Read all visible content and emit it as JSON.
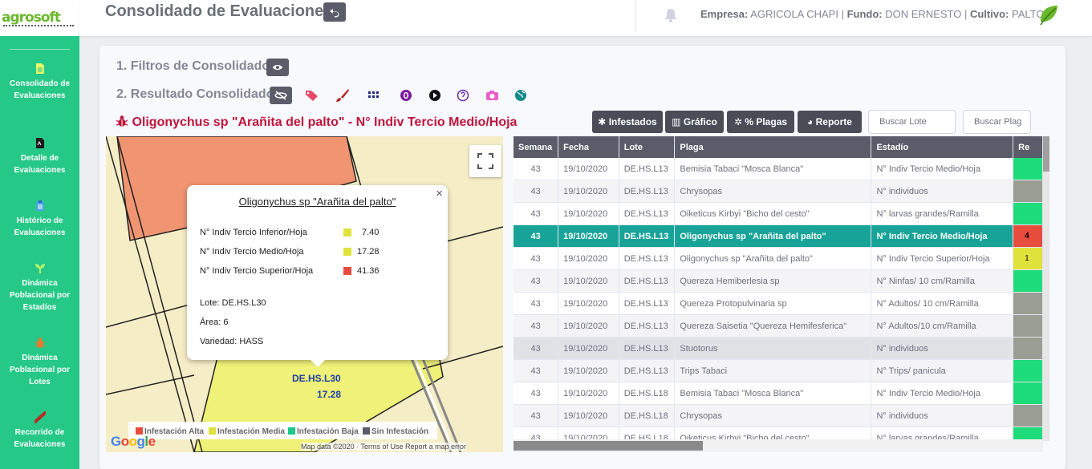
{
  "app": {
    "logo_text": "agrosoft",
    "page_title": "Consolidado de Evaluaciones"
  },
  "sidebar": {
    "items": [
      {
        "label": "Consolidado de Evaluaciones",
        "icon": "file-icon"
      },
      {
        "label": "Detalle de Evaluaciones",
        "icon": "pdf-icon"
      },
      {
        "label": "Histórico de Evaluaciones",
        "icon": "clipboard-icon"
      },
      {
        "label": "Dinámica Poblacional por Estadíos",
        "icon": "seedling-icon"
      },
      {
        "label": "Dinámica Poblacional por Lotes",
        "icon": "bug-icon"
      },
      {
        "label": "Recorrido de Evaluaciones",
        "icon": "route-icon"
      }
    ]
  },
  "header": {
    "empresa_label": "Empresa:",
    "empresa_value": "AGRICOLA CHAPI",
    "fundo_label": "Fundo:",
    "fundo_value": "DON ERNESTO",
    "cultivo_label": "Cultivo:",
    "cultivo_value": "PALTO"
  },
  "sections": {
    "filtros": "1. Filtros de Consolidado",
    "resultado": "2. Resultado Consolidado"
  },
  "toolbar_icon_colors": {
    "eye_slash": "#5a5c69",
    "tags": "#e74a6b",
    "brush": "#b52a26",
    "grid": "#1f2a8a",
    "circle_0": "#7a1aa0",
    "play": "#111111",
    "question": "#6a2aa8",
    "camera": "#e85fc4",
    "globe": "#138a8a"
  },
  "map": {
    "title": "Oligonychus sp \"Arañita del palto\" - N° Indiv Tercio Medio/Hoja",
    "popup": {
      "title": "Oligonychus sp \"Arañita del palto\"",
      "close": "×",
      "rows": [
        {
          "label": "N° Indiv Tercio Inferior/Hoja",
          "value": "7.40",
          "color": "#dfe23a"
        },
        {
          "label": "N° Indiv Tercio Medio/Hoja",
          "value": "17.28",
          "color": "#dfe23a"
        },
        {
          "label": "N° Indiv Tercio Superior/Hoja",
          "value": "41.36",
          "color": "#e74c3c"
        }
      ],
      "lote": "Lote: DE.HS.L30",
      "area": "Área: 6",
      "variedad": "Variedad: HASS"
    },
    "polygon_label": "DE.HS.L30",
    "polygon_value": "17.28",
    "legend": [
      {
        "label": "Infestación Alta",
        "color": "#e74c3c"
      },
      {
        "label": "Infestación Media",
        "color": "#dfe23a"
      },
      {
        "label": "Infestación Baja",
        "color": "#1cc88a"
      },
      {
        "label": "Sin Infestación",
        "color": "#5a5c69"
      }
    ],
    "google": "Google",
    "copyright": "Map data ©2020 · Terms of Use   Report a map error"
  },
  "buttons": {
    "infestados": "Infestados",
    "grafico": "Gráfico",
    "plagas": "% Plagas",
    "reporte": "Reporte"
  },
  "search": {
    "lote_placeholder": "Buscar Lote",
    "plaga_placeholder": "Buscar Plag"
  },
  "table": {
    "headers": [
      "Semana",
      "Fecha",
      "Lote",
      "Plaga",
      "Estadío",
      "Re"
    ],
    "rows": [
      {
        "semana": "43",
        "fecha": "19/10/2020",
        "lote": "DE.HS.L13",
        "plaga": "Bemisia Tabaci \"Mosca Blanca\"",
        "estadio": "N° Indiv Tercio Medio/Hoja",
        "color": "#1fdc7a",
        "re": ""
      },
      {
        "semana": "43",
        "fecha": "19/10/2020",
        "lote": "DE.HS.L13",
        "plaga": "Chrysopas",
        "estadio": "N° individuos",
        "color": "#9a9d92",
        "re": ""
      },
      {
        "semana": "43",
        "fecha": "19/10/2020",
        "lote": "DE.HS.L13",
        "plaga": "Oiketicus Kirbyi \"Bicho del cesto\"",
        "estadio": "N° larvas grandes/Ramilla",
        "color": "#1fdc7a",
        "re": ""
      },
      {
        "semana": "43",
        "fecha": "19/10/2020",
        "lote": "DE.HS.L13",
        "plaga": "Oligonychus sp \"Arañita del palto\"",
        "estadio": "N° Indiv Tercio Medio/Hoja",
        "color": "#e74c3c",
        "re": "4"
      },
      {
        "semana": "43",
        "fecha": "19/10/2020",
        "lote": "DE.HS.L13",
        "plaga": "Oligonychus sp \"Arañita del palto\"",
        "estadio": "N° Indiv Tercio Superior/Hoja",
        "color": "#dfe23a",
        "re": "1"
      },
      {
        "semana": "43",
        "fecha": "19/10/2020",
        "lote": "DE.HS.L13",
        "plaga": "Quereza Hemiberlesia sp",
        "estadio": "N° Ninfas/ 10 cm/Ramilla",
        "color": "#1fdc7a",
        "re": ""
      },
      {
        "semana": "43",
        "fecha": "19/10/2020",
        "lote": "DE.HS.L13",
        "plaga": "Quereza Protopulvinaria sp",
        "estadio": "N° Adultos/ 10 cm/Ramilla",
        "color": "#9a9d92",
        "re": ""
      },
      {
        "semana": "43",
        "fecha": "19/10/2020",
        "lote": "DE.HS.L13",
        "plaga": "Quereza Saisetia \"Quereza Hemifesferica\"",
        "estadio": "N° Adultos/10 cm/Ramilla",
        "color": "#9a9d92",
        "re": ""
      },
      {
        "semana": "43",
        "fecha": "19/10/2020",
        "lote": "DE.HS.L13",
        "plaga": "Stuotorus",
        "estadio": "N° individuos",
        "color": "#9a9d92",
        "re": ""
      },
      {
        "semana": "43",
        "fecha": "19/10/2020",
        "lote": "DE.HS.L13",
        "plaga": "Trips Tabaci",
        "estadio": "N° Trips/ panicula",
        "color": "#1fdc7a",
        "re": ""
      },
      {
        "semana": "43",
        "fecha": "19/10/2020",
        "lote": "DE.HS.L18",
        "plaga": "Bemisia Tabaci \"Mosca Blanca\"",
        "estadio": "N° Indiv Tercio Medio/Hoja",
        "color": "#1fdc7a",
        "re": ""
      },
      {
        "semana": "43",
        "fecha": "19/10/2020",
        "lote": "DE.HS.L18",
        "plaga": "Chrysopas",
        "estadio": "N° individuos",
        "color": "#9a9d92",
        "re": ""
      },
      {
        "semana": "43",
        "fecha": "19/10/2020",
        "lote": "DE.HS.L18",
        "plaga": "Oiketicus Kirbyi \"Bicho del cesto\"",
        "estadio": "N° larvas grandes/Ramilla",
        "color": "#1fdc7a",
        "re": ""
      }
    ]
  }
}
